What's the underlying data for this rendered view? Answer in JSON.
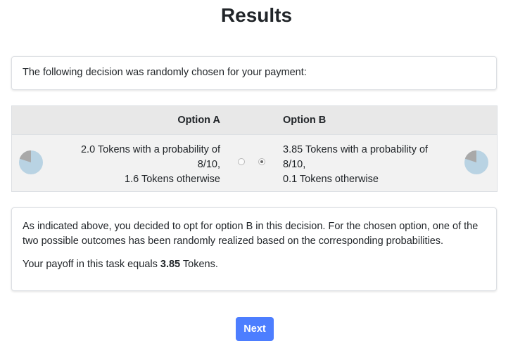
{
  "page": {
    "title": "Results"
  },
  "intro": {
    "text": "The following decision was randomly chosen for your payment:"
  },
  "decision": {
    "option_a": {
      "header": "Option A",
      "line1": "2.0 Tokens with a probability of",
      "line2": "8/10,",
      "line3": "1.6 Tokens otherwise",
      "selected": false
    },
    "option_b": {
      "header": "Option B",
      "line1": "3.85 Tokens with a probability of",
      "line2": "8/10,",
      "line3": "0.1 Tokens otherwise",
      "selected": true
    },
    "pie": {
      "probability": 0.8,
      "main_color": "#b9d3e3",
      "other_color": "#a9a9a9"
    }
  },
  "outcome": {
    "paragraph": "As indicated above, you decided to opt for option B in this decision. For the chosen option, one of the two possible outcomes has been randomly realized based on the corresponding probabilities.",
    "payoff_prefix": "Your payoff in this task equals ",
    "payoff_value": "3.85",
    "payoff_suffix": " Tokens."
  },
  "buttons": {
    "next_label": "Next",
    "next_color": "#4d7eff"
  }
}
